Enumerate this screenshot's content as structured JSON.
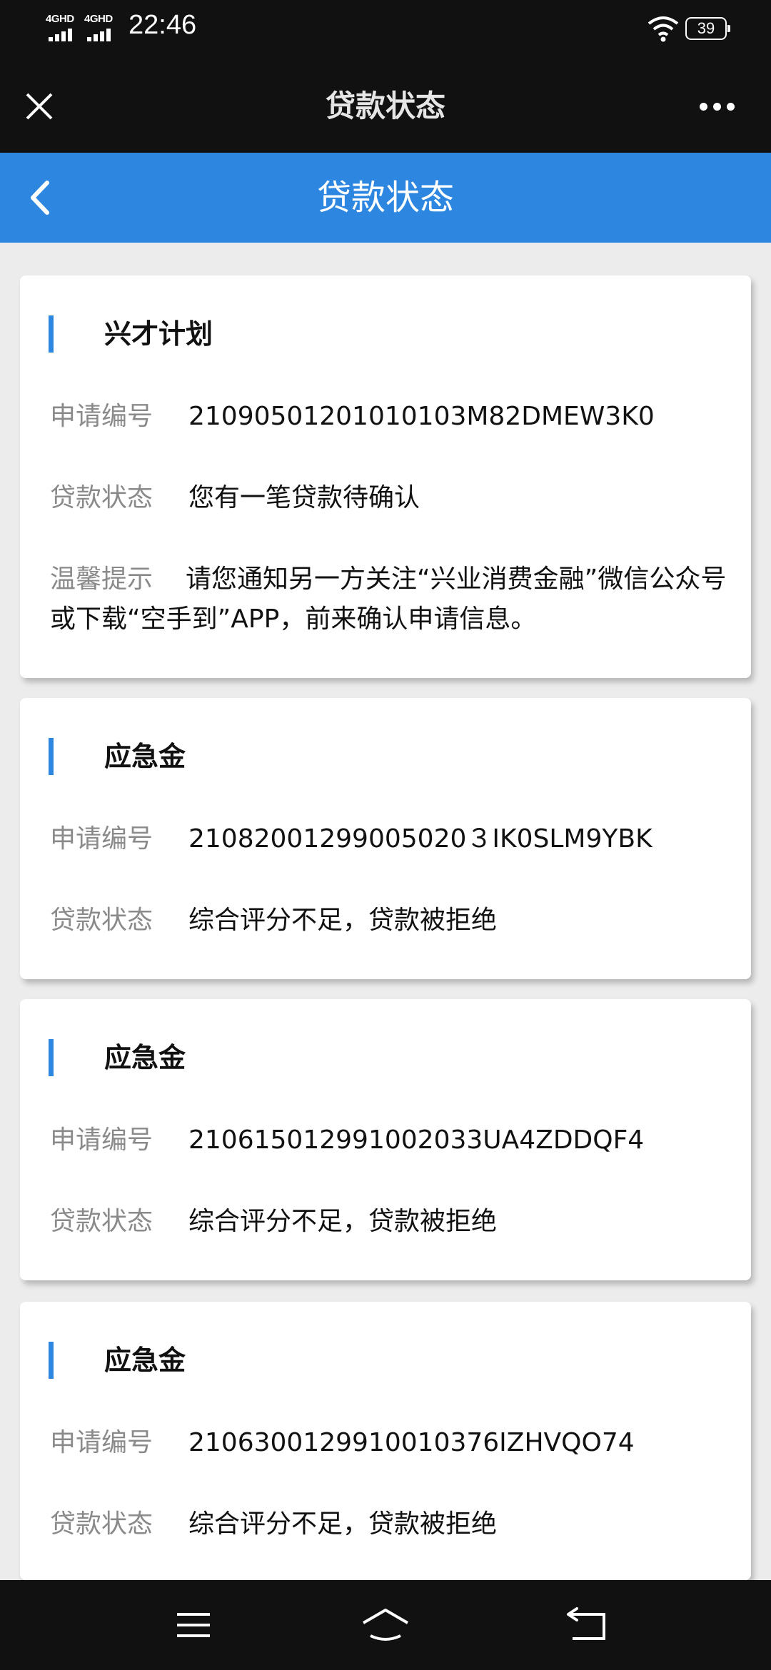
{
  "status_bar": {
    "signal_1": "4GHD",
    "signal_2": "4GHD",
    "time": "22:46",
    "battery": "39"
  },
  "title_bar": {
    "title": "贷款状态"
  },
  "header": {
    "title": "贷款状态"
  },
  "cards": [
    {
      "name": "兴才计划",
      "app_no_label": "申请编号",
      "app_no": "21090501201010103M82DMEW3K0",
      "status_label": "贷款状态",
      "status": "您有一笔贷款待确认",
      "tip_label": "温馨提示",
      "tip": "请您通知另一方关注“兴业消费金融”微信公众号或下载“空手到”APP，前来确认申请信息。"
    },
    {
      "name": "应急金",
      "app_no_label": "申请编号",
      "app_no": "21082001299005020３IK0SLM9YBK",
      "status_label": "贷款状态",
      "status": "综合评分不足，贷款被拒绝"
    },
    {
      "name": "应急金",
      "app_no_label": "申请编号",
      "app_no": "210615012991002033UA4ZDDQF4",
      "status_label": "贷款状态",
      "status": "综合评分不足，贷款被拒绝"
    },
    {
      "name": "应急金",
      "app_no_label": "申请编号",
      "app_no": "2106300129910010376IZHVQO74",
      "status_label": "贷款状态",
      "status": "综合评分不足，贷款被拒绝"
    }
  ],
  "colors": {
    "accent": "#2d87e0",
    "background": "#ececec",
    "label": "#8a8a8a"
  },
  "icons": {
    "close": "close-icon",
    "more": "more-icon",
    "back": "back-icon",
    "menu": "menu-icon",
    "home": "home-icon",
    "return": "return-icon"
  }
}
